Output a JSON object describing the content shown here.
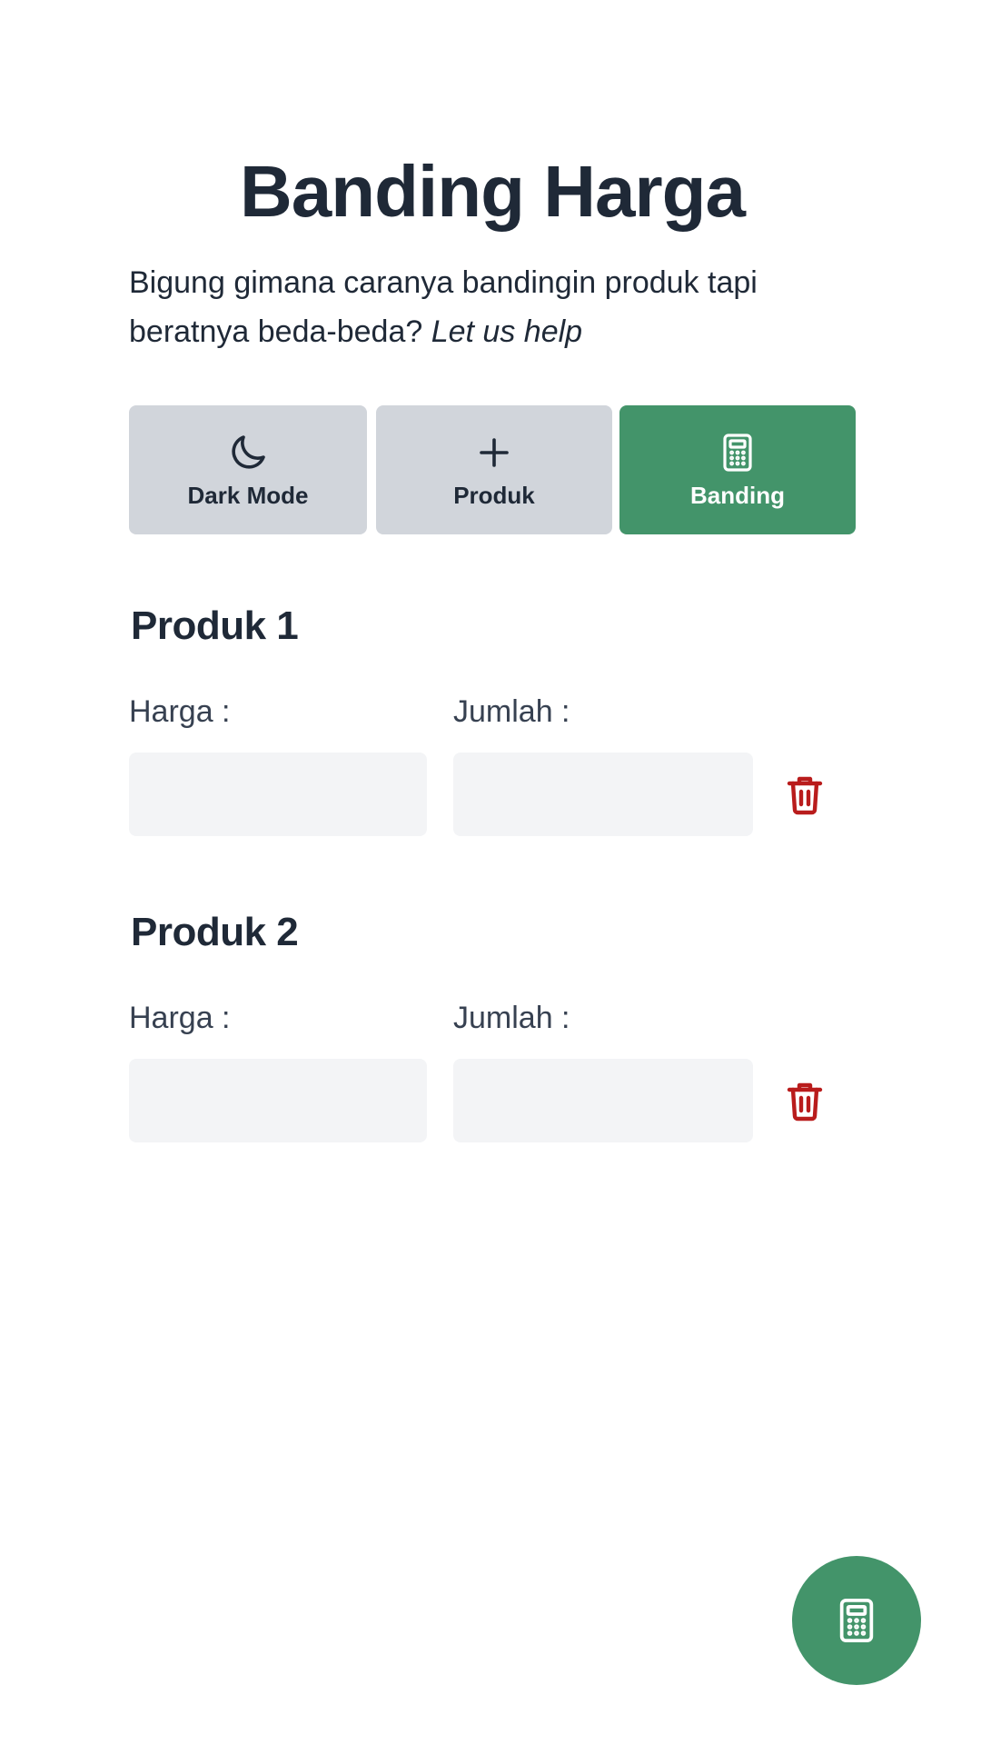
{
  "header": {
    "title": "Banding Harga",
    "subtitle_plain": "Bigung gimana caranya bandingin produk tapi beratnya beda-beda? ",
    "subtitle_italic": "Let us help"
  },
  "actions": {
    "dark_mode": {
      "label": "Dark Mode",
      "icon": "moon-icon"
    },
    "add_product": {
      "label": "Produk",
      "icon": "plus-icon"
    },
    "compare": {
      "label": "Banding",
      "icon": "calculator-icon"
    }
  },
  "products": [
    {
      "title": "Produk 1",
      "price_label": "Harga :",
      "price_value": "",
      "qty_label": "Jumlah :",
      "qty_value": ""
    },
    {
      "title": "Produk 2",
      "price_label": "Harga :",
      "price_value": "",
      "qty_label": "Jumlah :",
      "qty_value": ""
    }
  ],
  "fab": {
    "icon": "calculator-icon"
  },
  "colors": {
    "accent": "#43946a",
    "danger": "#b91c1c",
    "text": "#1f2937",
    "button_gray": "#d1d5db",
    "input_bg": "#f3f4f6"
  }
}
